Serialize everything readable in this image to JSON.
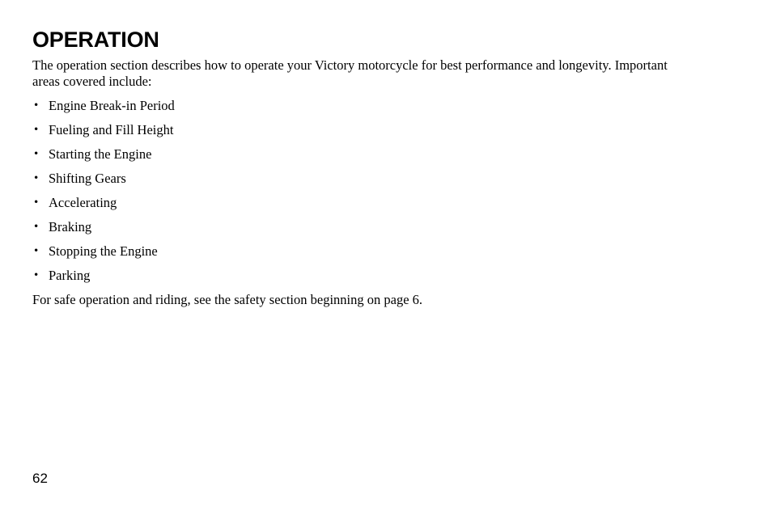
{
  "document": {
    "section_title": "OPERATION",
    "intro_paragraph": "The operation section describes how to operate your Victory motorcycle for best performance and longevity. Important areas covered include:",
    "bullet_marker": "•",
    "topics": [
      {
        "label": "Engine Break-in Period"
      },
      {
        "label": "Fueling and Fill Height"
      },
      {
        "label": "Starting the Engine"
      },
      {
        "label": "Shifting Gears"
      },
      {
        "label": "Accelerating"
      },
      {
        "label": "Braking"
      },
      {
        "label": "Stopping the Engine"
      },
      {
        "label": "Parking"
      }
    ],
    "closing_note": "For safe operation and riding, see the safety section beginning on page 6.",
    "page_number": "62"
  },
  "colors": {
    "page_background": "#ffffff",
    "text": "#000000"
  }
}
